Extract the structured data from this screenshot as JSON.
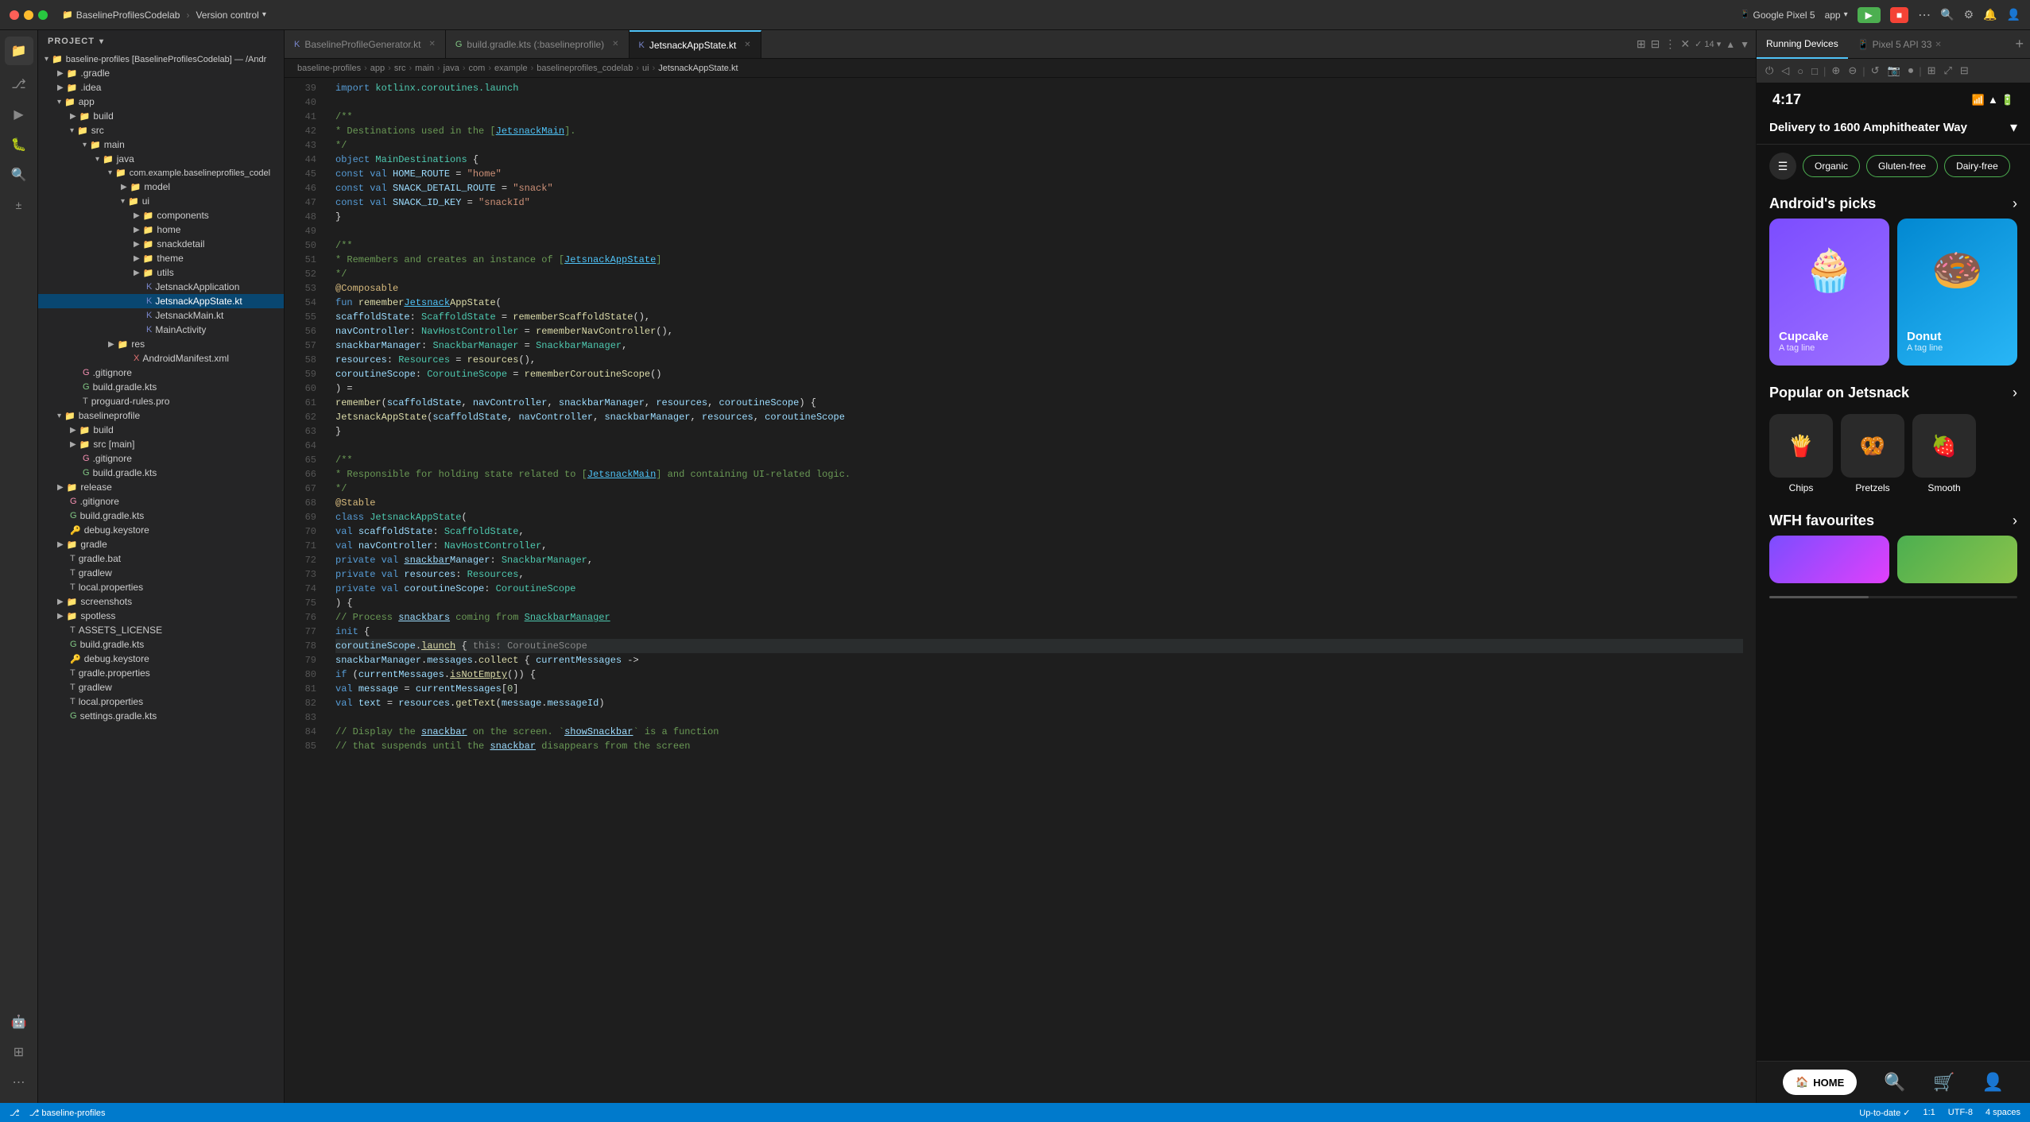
{
  "titlebar": {
    "traffic_lights": [
      "close",
      "minimize",
      "maximize"
    ],
    "project_name": "BaselineProfilesCodelab",
    "version_control": "Version control",
    "device": "Google Pixel 5",
    "app_label": "app",
    "run_btn": "▶",
    "pixel_api": "Pixel 5 API 33"
  },
  "file_tree": {
    "header": "Project",
    "items": [
      {
        "label": "baseline-profiles [BaselineProfilesCodelab]",
        "indent": 0,
        "type": "folder",
        "expanded": true
      },
      {
        "label": ".gradle",
        "indent": 1,
        "type": "folder",
        "expanded": false
      },
      {
        "label": ".idea",
        "indent": 1,
        "type": "folder",
        "expanded": false
      },
      {
        "label": "app",
        "indent": 1,
        "type": "folder",
        "expanded": true
      },
      {
        "label": "build",
        "indent": 2,
        "type": "folder",
        "expanded": false
      },
      {
        "label": "src",
        "indent": 2,
        "type": "folder",
        "expanded": true
      },
      {
        "label": "main",
        "indent": 3,
        "type": "folder",
        "expanded": true
      },
      {
        "label": "java",
        "indent": 4,
        "type": "folder",
        "expanded": true
      },
      {
        "label": "com.example.baselineprofiles_codel",
        "indent": 5,
        "type": "folder",
        "expanded": true
      },
      {
        "label": "model",
        "indent": 6,
        "type": "folder",
        "expanded": false
      },
      {
        "label": "ui",
        "indent": 6,
        "type": "folder",
        "expanded": true
      },
      {
        "label": "components",
        "indent": 7,
        "type": "folder",
        "expanded": false
      },
      {
        "label": "home",
        "indent": 7,
        "type": "folder",
        "expanded": false
      },
      {
        "label": "snackdetail",
        "indent": 7,
        "type": "folder",
        "expanded": false
      },
      {
        "label": "theme",
        "indent": 7,
        "type": "folder",
        "expanded": false
      },
      {
        "label": "utils",
        "indent": 7,
        "type": "folder",
        "expanded": false
      },
      {
        "label": "JetsnackApplication",
        "indent": 7,
        "type": "kt"
      },
      {
        "label": "JetsnackAppState.kt",
        "indent": 7,
        "type": "kt",
        "selected": true
      },
      {
        "label": "JetsnackMain.kt",
        "indent": 7,
        "type": "kt"
      },
      {
        "label": "MainActivity",
        "indent": 7,
        "type": "kt"
      },
      {
        "label": "res",
        "indent": 4,
        "type": "folder",
        "expanded": false
      },
      {
        "label": "AndroidManifest.xml",
        "indent": 5,
        "type": "xml"
      },
      {
        "label": ".gitignore",
        "indent": 2,
        "type": "git"
      },
      {
        "label": "build.gradle.kts",
        "indent": 2,
        "type": "gradle"
      },
      {
        "label": "proguard-rules.pro",
        "indent": 2,
        "type": "txt"
      },
      {
        "label": "baselineprofile",
        "indent": 1,
        "type": "folder",
        "expanded": true
      },
      {
        "label": "build",
        "indent": 2,
        "type": "folder",
        "expanded": false
      },
      {
        "label": "src [main]",
        "indent": 2,
        "type": "folder",
        "expanded": false
      },
      {
        "label": ".gitignore",
        "indent": 2,
        "type": "git"
      },
      {
        "label": "build.gradle.kts",
        "indent": 2,
        "type": "gradle"
      },
      {
        "label": ".gitignore",
        "indent": 0,
        "type": "git"
      },
      {
        "label": "build.gradle.kts",
        "indent": 0,
        "type": "gradle"
      },
      {
        "label": "debug.keystore",
        "indent": 0,
        "type": "txt"
      },
      {
        "label": "gradle",
        "indent": 0,
        "type": "folder",
        "expanded": false
      },
      {
        "label": "gradle.bat",
        "indent": 0,
        "type": "txt"
      },
      {
        "label": "gradlew",
        "indent": 0,
        "type": "txt"
      },
      {
        "label": "local.properties",
        "indent": 0,
        "type": "txt"
      },
      {
        "label": "screenshots",
        "indent": 0,
        "type": "folder",
        "expanded": false
      },
      {
        "label": "spotless",
        "indent": 0,
        "type": "folder",
        "expanded": false
      },
      {
        "label": "ASSETS_LICENSE",
        "indent": 0,
        "type": "txt"
      },
      {
        "label": "build.gradle.kts",
        "indent": 0,
        "type": "gradle"
      },
      {
        "label": "debug.keystore",
        "indent": 0,
        "type": "txt"
      },
      {
        "label": "gradle.properties",
        "indent": 0,
        "type": "txt"
      },
      {
        "label": "gradlew",
        "indent": 0,
        "type": "txt"
      },
      {
        "label": "local.properties",
        "indent": 0,
        "type": "txt"
      },
      {
        "label": "settings.gradle.kts",
        "indent": 0,
        "type": "gradle"
      },
      {
        "label": "release",
        "indent": 1,
        "type": "folder",
        "expanded": false
      }
    ]
  },
  "tabs": [
    {
      "label": "BaselineProfileGenerator.kt",
      "active": false
    },
    {
      "label": "build.gradle.kts (:baselineprofile)",
      "active": false
    },
    {
      "label": "JetsnackAppState.kt",
      "active": true
    }
  ],
  "editor": {
    "filename": "JetsnackAppState.kt",
    "lines": [
      {
        "num": 39,
        "code": "import kotlinx.coroutines.launch"
      },
      {
        "num": 40,
        "code": ""
      },
      {
        "num": 41,
        "code": "/**"
      },
      {
        "num": 42,
        "code": " * Destinations used in the [JetsnackMain]."
      },
      {
        "num": 43,
        "code": " */"
      },
      {
        "num": 44,
        "code": "object MainDestinations {"
      },
      {
        "num": 45,
        "code": "    const val HOME_ROUTE = \"home\""
      },
      {
        "num": 46,
        "code": "    const val SNACK_DETAIL_ROUTE = \"snack\""
      },
      {
        "num": 47,
        "code": "    const val SNACK_ID_KEY = \"snackId\""
      },
      {
        "num": 48,
        "code": "}"
      },
      {
        "num": 49,
        "code": ""
      },
      {
        "num": 50,
        "code": "/**"
      },
      {
        "num": 51,
        "code": " * Remembers and creates an instance of [JetsnackAppState]"
      },
      {
        "num": 52,
        "code": " */"
      },
      {
        "num": 53,
        "code": "@Composable"
      },
      {
        "num": 54,
        "code": "fun rememberJetsnackAppState("
      },
      {
        "num": 55,
        "code": "    scaffoldState: ScaffoldState = rememberScaffoldState(),"
      },
      {
        "num": 56,
        "code": "    navController: NavHostController = rememberNavController(),"
      },
      {
        "num": 57,
        "code": "    snackbarManager: SnackbarManager = SnackbarManager,"
      },
      {
        "num": 58,
        "code": "    resources: Resources = resources(),"
      },
      {
        "num": 59,
        "code": "    coroutineScope: CoroutineScope = rememberCoroutineScope()"
      },
      {
        "num": 60,
        "code": ") ="
      },
      {
        "num": 61,
        "code": "    remember(scaffoldState, navController, snackbarManager, resources, coroutineScope) {"
      },
      {
        "num": 62,
        "code": "        JetsnackAppState(scaffoldState, navController, snackbarManager, resources, coroutineScope"
      },
      {
        "num": 63,
        "code": "    }"
      },
      {
        "num": 64,
        "code": ""
      },
      {
        "num": 65,
        "code": "/**"
      },
      {
        "num": 66,
        "code": " * Responsible for holding state related to [JetsnackMain] and containing UI-related logic."
      },
      {
        "num": 67,
        "code": " */"
      },
      {
        "num": 68,
        "code": "@Stable"
      },
      {
        "num": 69,
        "code": "class JetsnackAppState("
      },
      {
        "num": 70,
        "code": "    val scaffoldState: ScaffoldState,"
      },
      {
        "num": 71,
        "code": "    val navController: NavHostController,"
      },
      {
        "num": 72,
        "code": "    private val snackbarManager: SnackbarManager,"
      },
      {
        "num": 73,
        "code": "    private val resources: Resources,"
      },
      {
        "num": 74,
        "code": "    private val coroutineScope: CoroutineScope"
      },
      {
        "num": 75,
        "code": ") {"
      },
      {
        "num": 76,
        "code": "    // Process snackbars coming from SnackbarManager"
      },
      {
        "num": 77,
        "code": "    init {"
      },
      {
        "num": 78,
        "code": "        coroutineScope.launch { this: CoroutineScope"
      },
      {
        "num": 79,
        "code": "            snackbarManager.messages.collect { currentMessages ->"
      },
      {
        "num": 80,
        "code": "                if (currentMessages.isNotEmpty()) {"
      },
      {
        "num": 81,
        "code": "                    val message = currentMessages[0]"
      },
      {
        "num": 82,
        "code": "                    val text = resources.getText(message.messageId)"
      },
      {
        "num": 83,
        "code": ""
      },
      {
        "num": 84,
        "code": "                    // Display the snackbar on the screen. `showSnackbar` is a function"
      },
      {
        "num": 85,
        "code": "                    // that suspends until the snackbar disappears from the screen"
      }
    ]
  },
  "running_devices": {
    "tab_label": "Running Devices",
    "pixel_label": "Pixel 5 API 33",
    "phone": {
      "time": "4:17",
      "delivery_text": "Delivery to 1600 Amphitheater Way",
      "filters": [
        "Organic",
        "Gluten-free",
        "Dairy-free"
      ],
      "sections": [
        {
          "title": "Android's picks",
          "items": [
            {
              "name": "Cupcake",
              "subtitle": "A tag line",
              "emoji": "🧁",
              "bg": "purple"
            },
            {
              "name": "Donut",
              "subtitle": "A tag line",
              "emoji": "🍩",
              "bg": "blue"
            }
          ]
        },
        {
          "title": "Popular on Jetsnack",
          "items": [
            {
              "name": "Chips",
              "emoji": "🍟"
            },
            {
              "name": "Pretzels",
              "emoji": "🥨"
            },
            {
              "name": "Smooth",
              "emoji": "🍓"
            }
          ]
        },
        {
          "title": "WFH favourites",
          "items": []
        }
      ],
      "nav": [
        "HOME",
        "🔍",
        "🛒",
        "👤"
      ]
    }
  },
  "breadcrumb": {
    "items": [
      "baseline-profiles",
      "app",
      "src",
      "main",
      "java",
      "com",
      "example",
      "baselineprofiles_codelab",
      "ui",
      "JetsnackAppState.kt"
    ]
  },
  "status_bar": {
    "git_branch": "⎇ baseline-profiles",
    "encoding": "UTF-8",
    "line_ending": "4 spaces",
    "position": "1:1",
    "status": "Up-to-date ✓"
  }
}
